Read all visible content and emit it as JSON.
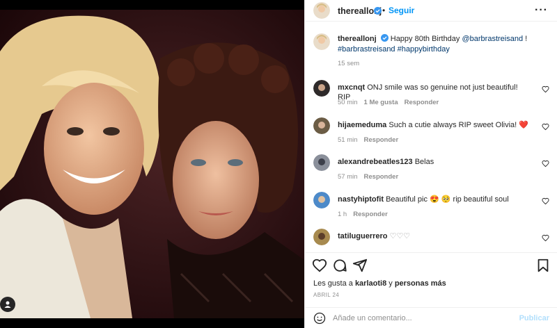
{
  "post": {
    "username": "thereallonj",
    "follow_label": "Seguir",
    "more_label": "···",
    "photo_alt": "Olivia Newton-John and Barbra Streisand"
  },
  "caption": {
    "username": "thereallonj",
    "text": "Happy 80th Birthday",
    "mention": "@barbrastreisand",
    "suffix": "!",
    "hashtags": "#barbrastreisand #happybirthday",
    "time": "15 sem"
  },
  "comments": [
    {
      "username": "mxcnqt",
      "text": "ONJ smile was so genuine not just beautiful! RIP",
      "time": "50 min",
      "likes": "1 Me gusta",
      "reply": "Responder"
    },
    {
      "username": "hijaemeduma",
      "text": "Such a cutie always RIP sweet Olivia! ❤️",
      "time": "51 min",
      "likes": "",
      "reply": "Responder"
    },
    {
      "username": "alexandrebeatles123",
      "text": "Belas",
      "time": "57 min",
      "likes": "",
      "reply": "Responder"
    },
    {
      "username": "nastyhiptofit",
      "text": "Beautiful pic 😍 🥺 rip beautiful soul",
      "time": "1 h",
      "likes": "",
      "reply": "Responder"
    },
    {
      "username": "tatiluguerrero",
      "text": "♡♡♡",
      "time": "",
      "likes": "",
      "reply": ""
    }
  ],
  "likes_line": {
    "prefix": "Les gusta a",
    "user": "karlaoti8",
    "joiner": "y",
    "others": "personas más"
  },
  "date": "ABRIL 24",
  "add_comment": {
    "placeholder": "Añade un comentario...",
    "post_label": "Publicar"
  },
  "colors": {
    "accent": "#0095f6",
    "link": "#00376b",
    "muted": "#8e8e8e",
    "verified": "#3897f0",
    "heart": "#ed4956"
  }
}
